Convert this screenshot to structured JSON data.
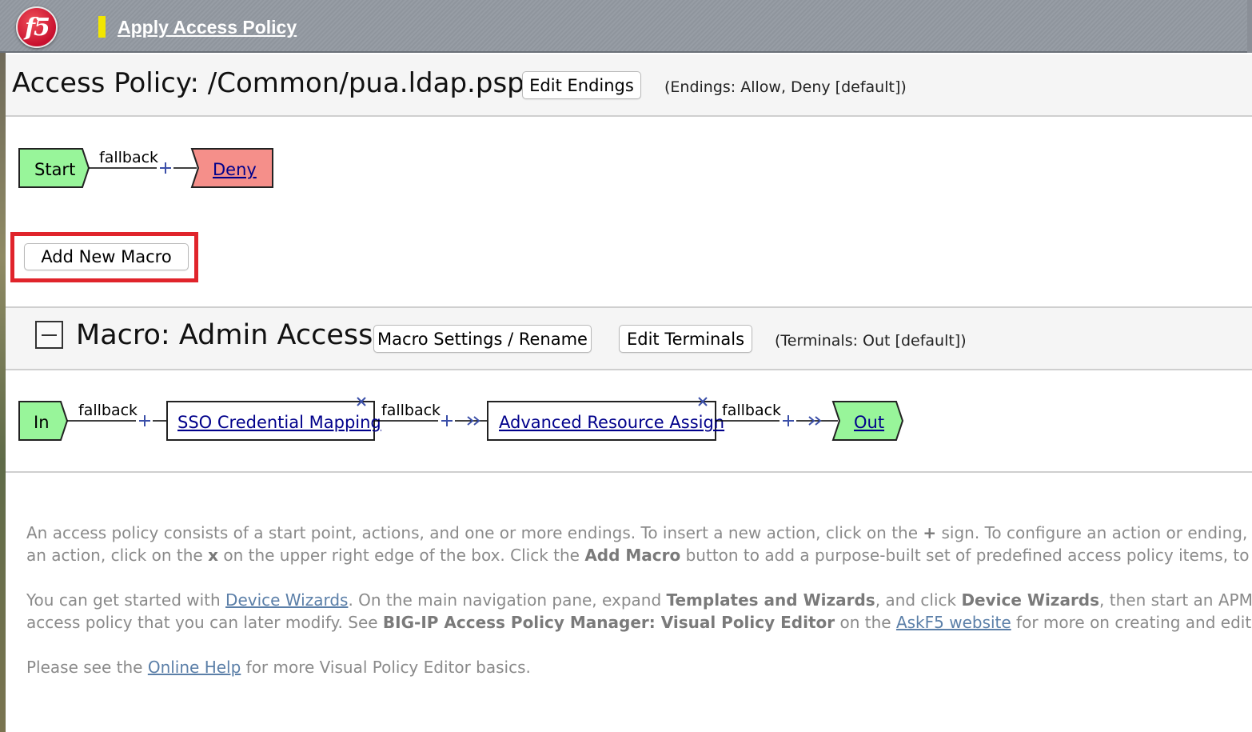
{
  "topbar": {
    "logo_text": "f5",
    "apply_label": "Apply Access Policy"
  },
  "policy": {
    "title": "Access Policy: /Common/pua.ldap.psp",
    "edit_endings_label": "Edit Endings",
    "endings_note": "(Endings: Allow, Deny [default])",
    "flow": {
      "start": "Start",
      "branch": "fallback",
      "end": "Deny"
    },
    "add_macro_label": "Add New Macro"
  },
  "macro": {
    "title": "Macro: Admin Access",
    "settings_label": "Macro Settings / Rename",
    "edit_terminals_label": "Edit Terminals",
    "terminals_note": "(Terminals: Out [default])",
    "flow": {
      "in": "In",
      "branch1": "fallback",
      "action1": "SSO Credential Mapping",
      "branch2": "fallback",
      "action2": "Advanced Resource Assign",
      "branch3": "fallback",
      "out": "Out"
    }
  },
  "help": {
    "p1_line1_a": "An access policy consists of a start point, actions, and one or more endings. To insert a new action, click on the ",
    "p1_line1_plus": "+",
    "p1_line1_b": " sign. To configure an action or ending, click",
    "p1_line2_a": "an action, click on the ",
    "p1_line2_x": "x",
    "p1_line2_b": " on the upper right edge of the box. Click the ",
    "p1_line2_bold": "Add Macro",
    "p1_line2_c": " button to add a purpose-built set of predefined access policy items, to simp",
    "p2_line1_a": "You can get started with ",
    "p2_line1_link": "Device Wizards",
    "p2_line1_b": ". On the main navigation pane, expand ",
    "p2_line1_bold1": "Templates and Wizards",
    "p2_line1_c": ", and click ",
    "p2_line1_bold2": "Device Wizards",
    "p2_line1_d": ", then start an APM Con",
    "p2_line2_a": "access policy that you can later modify. See ",
    "p2_line2_bold": "BIG-IP Access Policy Manager: Visual Policy Editor",
    "p2_line2_b": " on the ",
    "p2_line2_link": "AskF5 website",
    "p2_line2_c": " for more on creating and editing a",
    "p3_a": "Please see the ",
    "p3_link": "Online Help",
    "p3_b": " for more Visual Policy Editor basics."
  },
  "colors": {
    "start_fill": "#98f59a",
    "deny_fill": "#f58f8a",
    "highlight": "#e0242b",
    "link": "#00008b"
  }
}
